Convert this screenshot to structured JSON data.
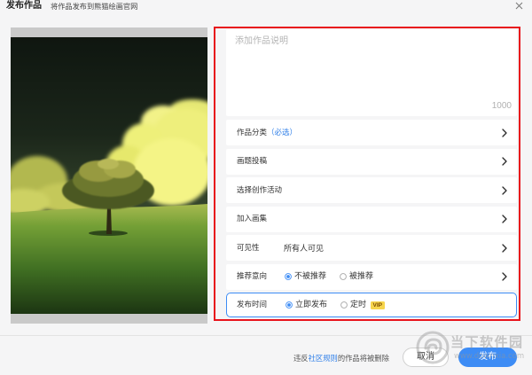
{
  "window": {
    "title": "发布作品",
    "subtitle": "将作品发布到熊猫绘画官网",
    "close_icon": "close-icon"
  },
  "form": {
    "description": {
      "placeholder": "添加作品说明",
      "counter": "1000"
    },
    "category": {
      "label": "作品分类",
      "hint": "（必选）",
      "icon": "chevron-right-icon"
    },
    "topic": {
      "label": "画题投稿",
      "icon": "chevron-right-icon"
    },
    "activity": {
      "label": "选择创作活动",
      "icon": "chevron-right-icon"
    },
    "collection": {
      "label": "加入画集",
      "icon": "chevron-right-icon"
    },
    "visibility": {
      "label": "可见性",
      "value": "所有人可见",
      "icon": "chevron-right-icon"
    },
    "recommend": {
      "label": "推荐意向",
      "icon": "chevron-right-icon",
      "options": [
        {
          "label": "不被推荐",
          "selected": true
        },
        {
          "label": "被推荐",
          "selected": false
        }
      ]
    },
    "publish_time": {
      "label": "发布时间",
      "options": [
        {
          "label": "立即发布",
          "selected": true
        },
        {
          "label": "定时",
          "selected": false,
          "badge": "VIP"
        }
      ]
    }
  },
  "footer": {
    "notice_prefix": "违反",
    "notice_link": "社区规则",
    "notice_suffix": "的作品将被删除",
    "cancel_label": "取消",
    "publish_label": "发布"
  },
  "watermark": {
    "name": "当下软件园",
    "url": "www.downxia.com",
    "icon": "watermark-logo-icon"
  },
  "colors": {
    "accent": "#3d8cf5",
    "link": "#2f7fe8",
    "annotation": "#e8141c",
    "vip_badge": "#f7d54c",
    "text": "#333333",
    "placeholder": "#b4b4b4"
  }
}
